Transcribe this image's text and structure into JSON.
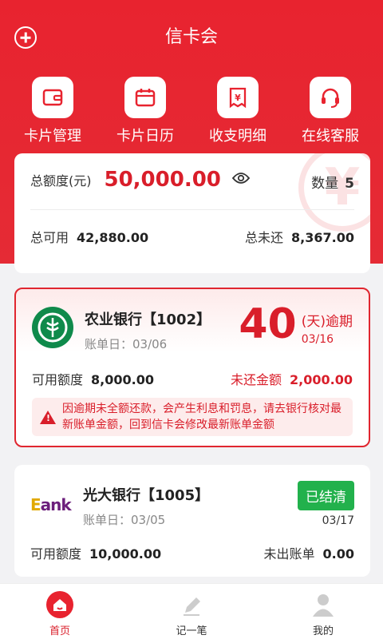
{
  "header": {
    "title": "信卡会"
  },
  "quick_actions": [
    {
      "label": "卡片管理",
      "icon": "card-icon"
    },
    {
      "label": "卡片日历",
      "icon": "calendar-icon"
    },
    {
      "label": "收支明细",
      "icon": "receipt-icon"
    },
    {
      "label": "在线客服",
      "icon": "headset-icon"
    }
  ],
  "summary": {
    "total_limit_label": "总额度(元)",
    "total_limit_value": "50,000.00",
    "count_label": "数量",
    "count_value": "5",
    "available_label": "总可用",
    "available_value": "42,880.00",
    "unpaid_label": "总未还",
    "unpaid_value": "8,367.00",
    "watermark": "¥"
  },
  "cards": [
    {
      "bank": "农业银行【1002】",
      "bill_day": "账单日：03/06",
      "overdue_days": "40",
      "overdue_unit": "(天)逾期",
      "overdue_date": "03/16",
      "available_label": "可用额度",
      "available_value": "8,000.00",
      "unpaid_label": "未还金额",
      "unpaid_value": "2,000.00",
      "warning": "因逾期未全额还款，会产生利息和罚息，请去银行核对最新账单金额，回到信卡会修改最新账单金额"
    },
    {
      "bank": "光大银行【1005】",
      "logo_text_prefix": "E",
      "logo_text": "ank",
      "bill_day": "账单日：03/05",
      "status": "已结清",
      "status_date": "03/17",
      "available_label": "可用额度",
      "available_value": "10,000.00",
      "bill_label": "未出账单",
      "bill_value": "0.00"
    }
  ],
  "bottom_nav": [
    {
      "label": "首页",
      "active": true
    },
    {
      "label": "记一笔",
      "active": false
    },
    {
      "label": "我的",
      "active": false
    }
  ],
  "colors": {
    "brand_red": "#e8232f",
    "green": "#22b14c"
  }
}
